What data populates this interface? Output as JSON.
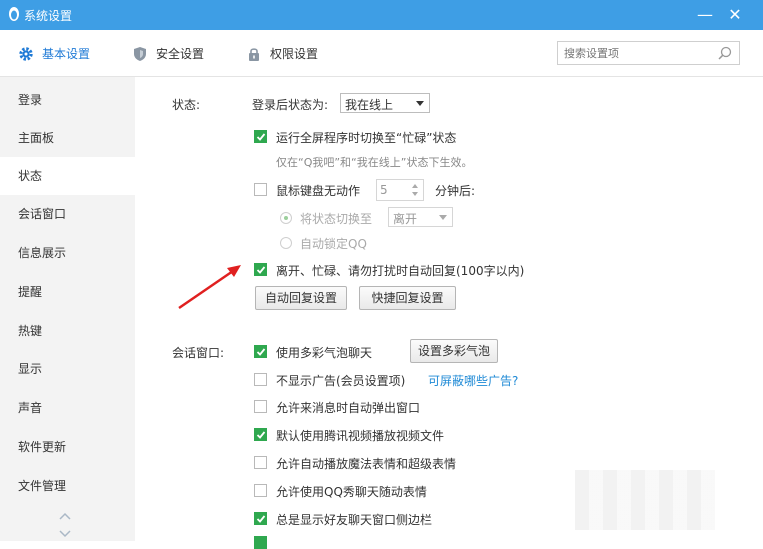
{
  "window": {
    "title": "系统设置",
    "minimize_label": "—",
    "close_label": "✕"
  },
  "topnav": {
    "tabs": [
      {
        "label": "基本设置",
        "icon": "gear-icon",
        "active": true
      },
      {
        "label": "安全设置",
        "icon": "shield-icon",
        "active": false
      },
      {
        "label": "权限设置",
        "icon": "lock-icon",
        "active": false
      }
    ],
    "search_placeholder": "搜索设置项"
  },
  "sidebar": {
    "items": [
      {
        "label": "登录"
      },
      {
        "label": "主面板"
      },
      {
        "label": "状态",
        "active": true
      },
      {
        "label": "会话窗口"
      },
      {
        "label": "信息展示"
      },
      {
        "label": "提醒"
      },
      {
        "label": "热键"
      },
      {
        "label": "显示"
      },
      {
        "label": "声音"
      },
      {
        "label": "软件更新"
      },
      {
        "label": "文件管理"
      }
    ]
  },
  "status_section": {
    "label": "状态:",
    "login_status_label": "登录后状态为:",
    "login_status_value": "我在线上",
    "fullscreen_busy": {
      "label": "运行全屏程序时切换至“忙碌”状态",
      "checked": true
    },
    "fullscreen_hint": "仅在“Q我吧”和“我在线上”状态下生效。",
    "idle": {
      "label": "鼠标键盘无动作",
      "checked": false,
      "minutes": "5",
      "suffix": "分钟后:"
    },
    "switch_to": {
      "label": "将状态切换至",
      "value": "离开",
      "checked": true
    },
    "auto_lock": {
      "label": "自动锁定QQ",
      "checked": false
    },
    "auto_reply": {
      "label": "离开、忙碌、请勿打扰时自动回复(100字以内)",
      "checked": true
    },
    "auto_reply_button": "自动回复设置",
    "quick_reply_button": "快捷回复设置"
  },
  "chat_section": {
    "label": "会话窗口:",
    "items": [
      {
        "label": "使用多彩气泡聊天",
        "checked": true
      },
      {
        "label": "不显示广告(会员设置项)",
        "checked": false
      },
      {
        "label": "允许来消息时自动弹出窗口",
        "checked": false
      },
      {
        "label": "默认使用腾讯视频播放视频文件",
        "checked": true
      },
      {
        "label": "允许自动播放魔法表情和超级表情",
        "checked": false
      },
      {
        "label": "允许使用QQ秀聊天随动表情",
        "checked": false
      },
      {
        "label": "总是显示好友聊天窗口侧边栏",
        "checked": true
      }
    ],
    "bubble_button": "设置多彩气泡",
    "ad_link": "可屏蔽哪些广告?"
  },
  "colors": {
    "titlebar": "#3e9ee5",
    "accent": "#1f7ad6",
    "check_green": "#2fa84f",
    "arrow_red": "#e02020"
  }
}
